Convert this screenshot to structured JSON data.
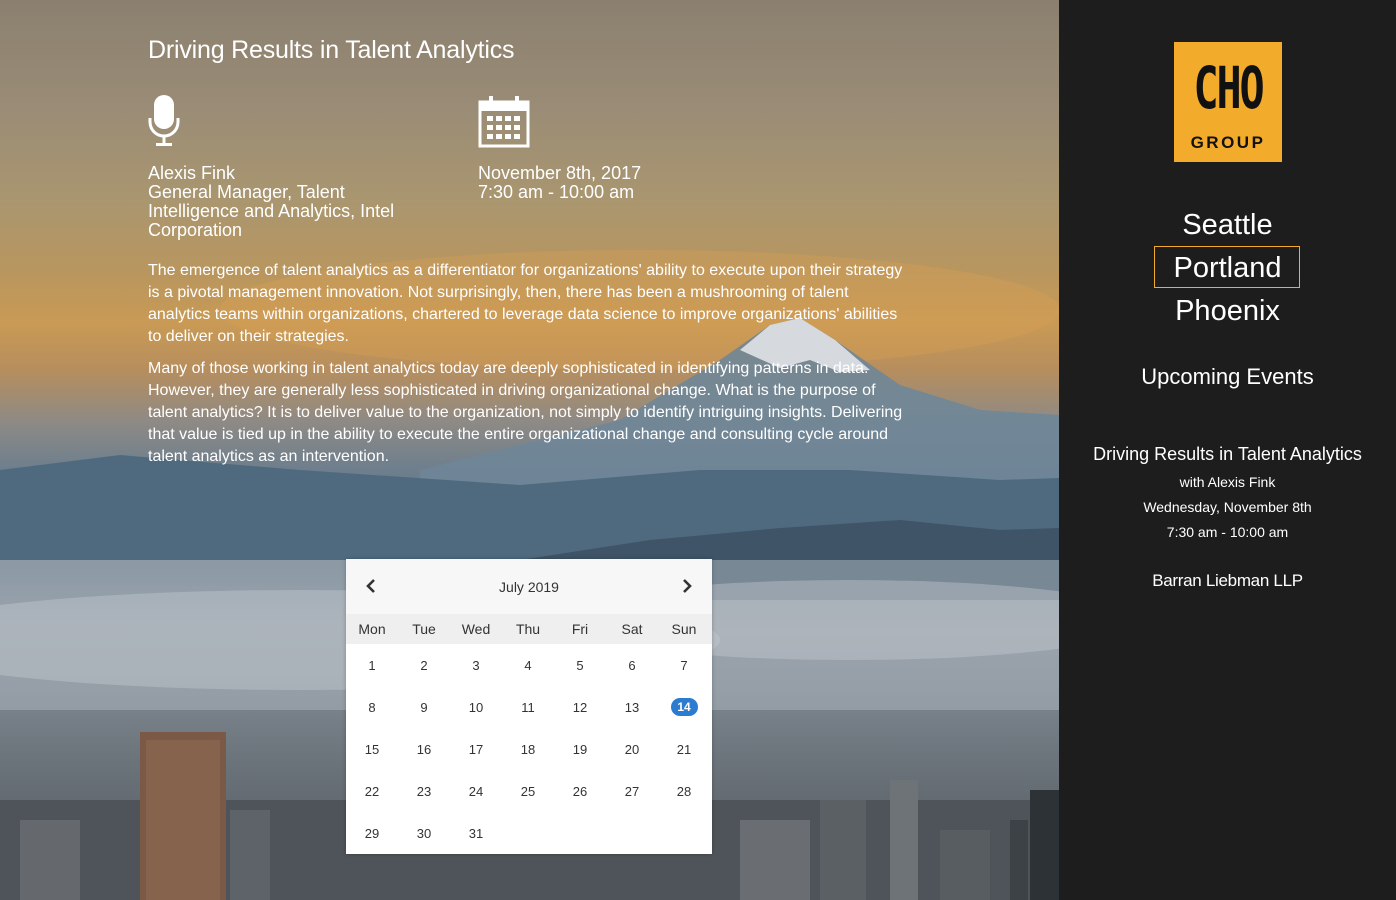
{
  "event": {
    "title": "Driving Results in Talent Analytics",
    "speaker": {
      "name": "Alexis Fink",
      "role_line1": "General Manager, Talent",
      "role_line2": "Intelligence and Analytics, Intel",
      "role_line3": "Corporation"
    },
    "when": {
      "date": "November 8th, 2017",
      "time": "7:30 am - 10:00 am"
    },
    "description": [
      "The emergence of talent analytics as a differentiator for organizations' ability to execute upon their strategy is a pivotal management innovation. Not surprisingly, then, there has been a mushrooming of talent analytics teams within organizations, chartered to leverage data science to improve organizations' abilities to deliver on their strategies.",
      "Many of those working in talent analytics today are deeply sophisticated in identifying patterns in data. However, they are generally less sophisticated in driving organizational change. What is the purpose of talent analytics? It is to deliver value to the organization, not simply to identify intriguing insights. Delivering that value is tied up in the ability to execute the entire organizational change and consulting cycle around talent analytics as an intervention."
    ]
  },
  "calendar": {
    "month_label": "July 2019",
    "weekdays": [
      "Mon",
      "Tue",
      "Wed",
      "Thu",
      "Fri",
      "Sat",
      "Sun"
    ],
    "days": [
      1,
      2,
      3,
      4,
      5,
      6,
      7,
      8,
      9,
      10,
      11,
      12,
      13,
      14,
      15,
      16,
      17,
      18,
      19,
      20,
      21,
      22,
      23,
      24,
      25,
      26,
      27,
      28,
      29,
      30,
      31
    ],
    "today": 14,
    "today_color": "#2b7bd1"
  },
  "sidebar": {
    "logo_main": "CHO",
    "logo_sub": "GROUP",
    "cities": [
      "Seattle",
      "Portland",
      "Phoenix"
    ],
    "active_city": "Portland",
    "upcoming_heading": "Upcoming Events",
    "upcoming_event": {
      "title": "Driving Results in Talent Analytics",
      "with": "with Alexis Fink",
      "date": "Wednesday, November 8th",
      "time": "7:30 am - 10:00 am",
      "venue": "Barran Liebman LLP"
    },
    "accent_color": "#f2ab2b"
  },
  "icons": {
    "speaker": "microphone-icon",
    "date": "calendar-icon",
    "prev": "chevron-left-icon",
    "next": "chevron-right-icon"
  }
}
